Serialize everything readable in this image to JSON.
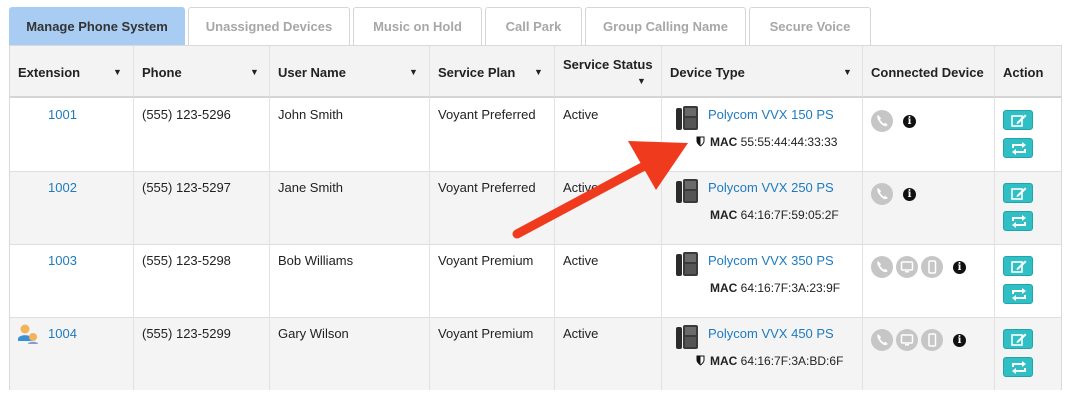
{
  "tabs": [
    {
      "label": "Manage Phone System",
      "active": true
    },
    {
      "label": "Unassigned Devices",
      "active": false
    },
    {
      "label": "Music on Hold",
      "active": false
    },
    {
      "label": "Call Park",
      "active": false
    },
    {
      "label": "Group Calling Name",
      "active": false
    },
    {
      "label": "Secure Voice",
      "active": false
    }
  ],
  "columns": {
    "extension": "Extension",
    "phone": "Phone",
    "user_name": "User Name",
    "service_plan": "Service Plan",
    "service_status": "Service Status",
    "device_type": "Device Type",
    "connected_device": "Connected Device",
    "action": "Action"
  },
  "mac_label": "MAC",
  "rows": [
    {
      "extension": "1001",
      "phone": "(555) 123-5296",
      "user_name": "John Smith",
      "service_plan": "Voyant Preferred",
      "service_status": "Active",
      "device": "Polycom VVX 150 PS",
      "mac": "55:55:44:44:33:33",
      "secure": true,
      "connected": [
        "phone-icon"
      ],
      "user_icon": false
    },
    {
      "extension": "1002",
      "phone": "(555) 123-5297",
      "user_name": "Jane Smith",
      "service_plan": "Voyant Preferred",
      "service_status": "Active",
      "device": "Polycom VVX 250 PS",
      "mac": "64:16:7F:59:05:2F",
      "secure": false,
      "connected": [
        "phone-icon"
      ],
      "user_icon": false
    },
    {
      "extension": "1003",
      "phone": "(555) 123-5298",
      "user_name": "Bob Williams",
      "service_plan": "Voyant Premium",
      "service_status": "Active",
      "device": "Polycom VVX 350 PS",
      "mac": "64:16:7F:3A:23:9F",
      "secure": false,
      "connected": [
        "phone-icon",
        "desktop-icon",
        "mobile-icon"
      ],
      "user_icon": false
    },
    {
      "extension": "1004",
      "phone": "(555) 123-5299",
      "user_name": "Gary Wilson",
      "service_plan": "Voyant Premium",
      "service_status": "Active",
      "device": "Polycom VVX 450 PS",
      "mac": "64:16:7F:3A:BD:6F",
      "secure": true,
      "connected": [
        "phone-icon",
        "desktop-icon",
        "mobile-icon"
      ],
      "user_icon": true
    }
  ],
  "colors": {
    "active_tab": "#a9cdf2",
    "link": "#1f7bbf",
    "action_button": "#2fbfc4",
    "annotation_arrow": "#f03a1e"
  }
}
